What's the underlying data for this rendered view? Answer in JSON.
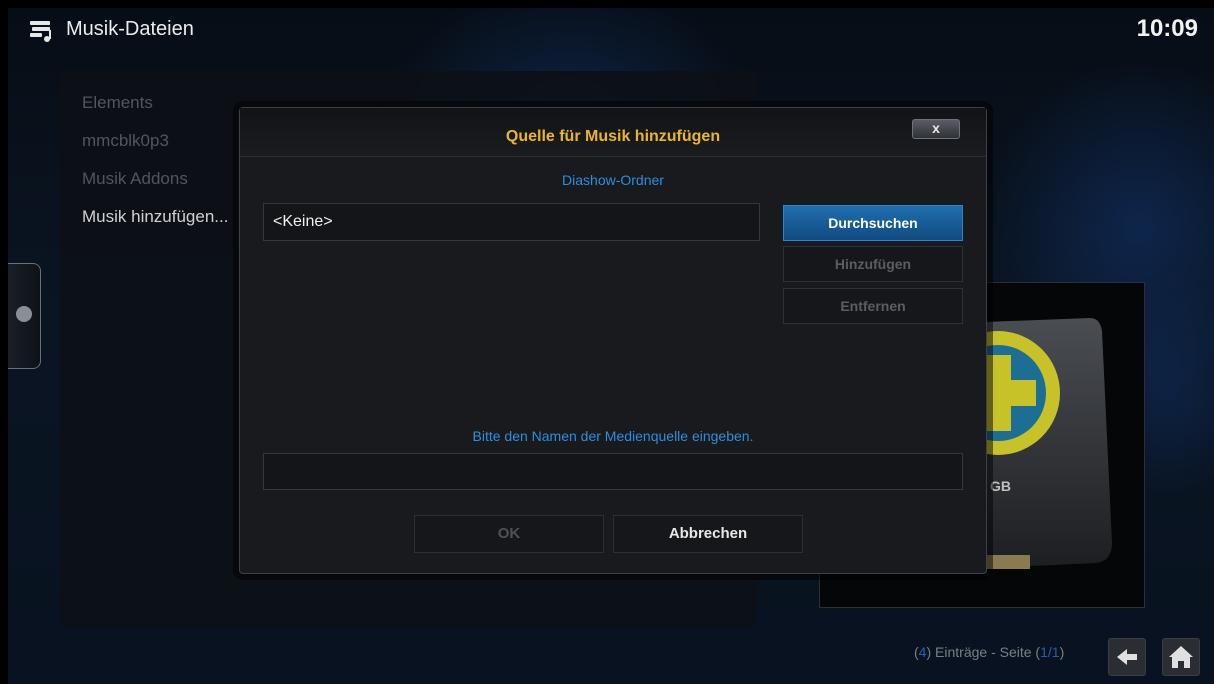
{
  "header": {
    "title": "Musik-Dateien",
    "clock": "10:09"
  },
  "list": {
    "items": [
      "Elements",
      "mmcblk0p3",
      "Musik Addons",
      "Musik hinzufügen..."
    ]
  },
  "dialog": {
    "title": "Quelle für Musik hinzufügen",
    "close_label": "x",
    "section_label": "Diashow-Ordner",
    "path_value": "<Keine>",
    "buttons": {
      "browse": "Durchsuchen",
      "add": "Hinzufügen",
      "remove": "Entfernen"
    },
    "name_prompt": "Bitte den Namen der Medienquelle eingeben.",
    "name_value": "",
    "ok": "OK",
    "cancel": "Abbrechen"
  },
  "footer": {
    "count": "4",
    "entries_text": "Einträge - Seite",
    "page": "1/1"
  },
  "preview": {
    "label": "GB"
  },
  "colors": {
    "accent": "#ebb52b",
    "link": "#2a8fe0",
    "focus": "#1f6fb0"
  },
  "icons": [
    "music-files-icon",
    "close-icon",
    "back-arrow-icon",
    "home-icon",
    "side-menu-icon",
    "add-source-icon"
  ]
}
